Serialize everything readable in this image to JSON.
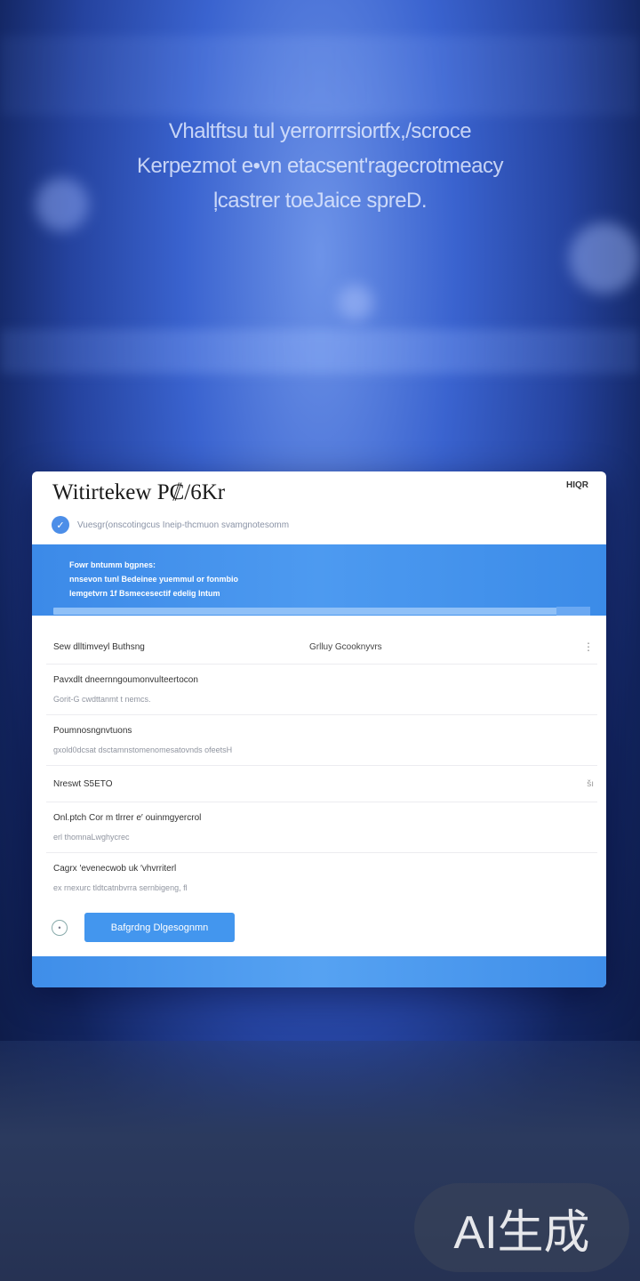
{
  "headline": {
    "lines": [
      "Vhaltftsu tul yerrorrrsiortfx,/scroce",
      "Kerpezmot e•vn etacsent'ragecrotmeacy",
      "ļcastrer toeJaice spreD."
    ]
  },
  "card": {
    "title": "Witirtekew P₡/6Kr",
    "corner_label": "HIQR",
    "subtitle": "Vuesgr(onscotingcus Ineip-thcmuon svamgnotesomm",
    "banner": {
      "lines": [
        "Fowr bntumm bgpnes:",
        "nnsevon tunl Bedeinee yuemmul or fonmbio",
        "lemgetvrn 1f Bsmecesectif edelig Intum"
      ]
    },
    "list": {
      "header": {
        "left": "Sew dlltimveyl Buthsng",
        "middle": "Grlluy Gcooknyvrs",
        "kebab": "⋮"
      },
      "items": [
        {
          "primary": "Pavxdlt dneernngoumonvulteertocon",
          "secondary": "Gorit-G cwdttanmt t nemcs."
        },
        {
          "primary": "Poumnosngnvtuons",
          "secondary": "gxold0dcsat dsctamnstomenomesatovnds ofeetsH"
        }
      ],
      "flag_row": {
        "label": "Nreswt S5ETO",
        "value": "šı"
      },
      "items2": [
        {
          "primary": "Onl.ptch Cor m tlrrer e′ ouinmgyercrol",
          "secondary": "erl thomnaLwghycrec"
        },
        {
          "primary": "Cagrx ′evenecwob uk ′vhvrriterl",
          "secondary": "ex rnexurc tldtcatnbvrra sernbigeng, fl"
        }
      ]
    },
    "footer": {
      "info_icon": "•",
      "button_label": "Bafgrdng Dlgesognmn"
    }
  },
  "watermark": "AI生成",
  "icons": {
    "sub_icon": "check-circle-icon",
    "info_icon": "info-circle-icon",
    "kebab": "kebab-menu-icon"
  },
  "colors": {
    "accent": "#4396ee",
    "banner": "#3c8ae8",
    "background": "#2a4fb8"
  }
}
